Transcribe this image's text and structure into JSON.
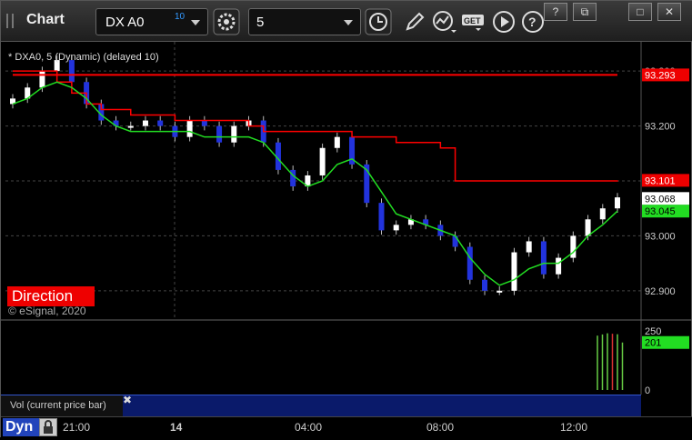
{
  "app": {
    "title": "Chart"
  },
  "toolbar": {
    "symbol": "DX A0",
    "symbol_superscript": "10",
    "interval": "5",
    "icons": [
      "gear-icon",
      "clock-icon",
      "pencil-icon",
      "study-icon",
      "get-icon",
      "play-icon",
      "help-icon"
    ]
  },
  "window_buttons": {
    "help": "?",
    "restore": "⧉",
    "maximize": "□",
    "close": "✕"
  },
  "chart": {
    "label": "* DXA0, 5 (Dynamic) (delayed 10)",
    "direction_badge": "Direction",
    "copyright": "© eSignal, 2020",
    "price_labels": {
      "upper_red": "93.293",
      "lower_red": "93.101",
      "last": "93.068",
      "green": "93.045"
    },
    "price_ticks": [
      "93.300",
      "93.200",
      "93.100",
      "93.000",
      "92.900"
    ],
    "volume_ticks": [
      "250",
      "201",
      "0"
    ],
    "volume_pane_label": "Vol (current price bar)",
    "time_ticks": [
      "21:00",
      "14",
      "04:00",
      "08:00",
      "12:00"
    ],
    "footer_label": "Dyn"
  },
  "colors": {
    "up_candle": "#ffffff",
    "down_candle": "#2233dd",
    "red_line": "#ff0000",
    "green_line": "#22dd22",
    "volume_bars": "#66cc44",
    "volume_bar_red": "#dd3333"
  },
  "chart_data": {
    "type": "line",
    "title": "",
    "ylim": [
      92.86,
      93.34
    ],
    "series": [
      {
        "name": "",
        "values": [
          93.25,
          93.27,
          93.3,
          93.32,
          93.28,
          93.24,
          93.21,
          93.2,
          93.2,
          93.21,
          93.2,
          93.18,
          93.21,
          93.2,
          93.17,
          93.2,
          93.21,
          93.17,
          93.12,
          93.09,
          93.11,
          93.16,
          93.18,
          93.13,
          93.06,
          93.01,
          93.02,
          93.03,
          93.02,
          93.0,
          92.98,
          92.92,
          92.9,
          92.9,
          92.97,
          92.99,
          92.93,
          92.96,
          93.0,
          93.03,
          93.05,
          93.07
        ]
      },
      {
        "name": "",
        "values": [
          93.293,
          93.293,
          93.293,
          93.293,
          93.293,
          93.293,
          93.293,
          93.293,
          93.293,
          93.293,
          93.293,
          93.293,
          93.293,
          93.293,
          93.293,
          93.293,
          93.293,
          93.293,
          93.293,
          93.293,
          93.293,
          93.293,
          93.293,
          93.293,
          93.293,
          93.293,
          93.293,
          93.293,
          93.293,
          93.293,
          93.293,
          93.293,
          93.293,
          93.293,
          93.293,
          93.293,
          93.293,
          93.293,
          93.293,
          93.293,
          93.293,
          93.293
        ]
      },
      {
        "name": "",
        "values": [
          93.3,
          93.3,
          93.3,
          93.28,
          93.26,
          93.24,
          93.23,
          93.23,
          93.22,
          93.22,
          93.22,
          93.21,
          93.21,
          93.21,
          93.21,
          93.21,
          93.2,
          93.19,
          93.19,
          93.19,
          93.19,
          93.19,
          93.19,
          93.18,
          93.18,
          93.18,
          93.17,
          93.17,
          93.17,
          93.16,
          93.1,
          93.1,
          93.1,
          93.1,
          93.1,
          93.1,
          93.1,
          93.1,
          93.1,
          93.1,
          93.1,
          93.101
        ]
      },
      {
        "name": "",
        "values": [
          93.24,
          93.25,
          93.27,
          93.28,
          93.27,
          93.25,
          93.22,
          93.2,
          93.19,
          93.19,
          93.19,
          93.19,
          93.19,
          93.18,
          93.18,
          93.18,
          93.18,
          93.17,
          93.14,
          93.11,
          93.09,
          93.1,
          93.13,
          93.14,
          93.12,
          93.08,
          93.04,
          93.03,
          93.02,
          93.01,
          93.0,
          92.96,
          92.93,
          92.91,
          92.92,
          92.94,
          92.95,
          92.95,
          92.97,
          93.0,
          93.02,
          93.045
        ]
      }
    ],
    "volume": [
      230,
      235,
      240,
      238,
      236,
      201
    ]
  }
}
